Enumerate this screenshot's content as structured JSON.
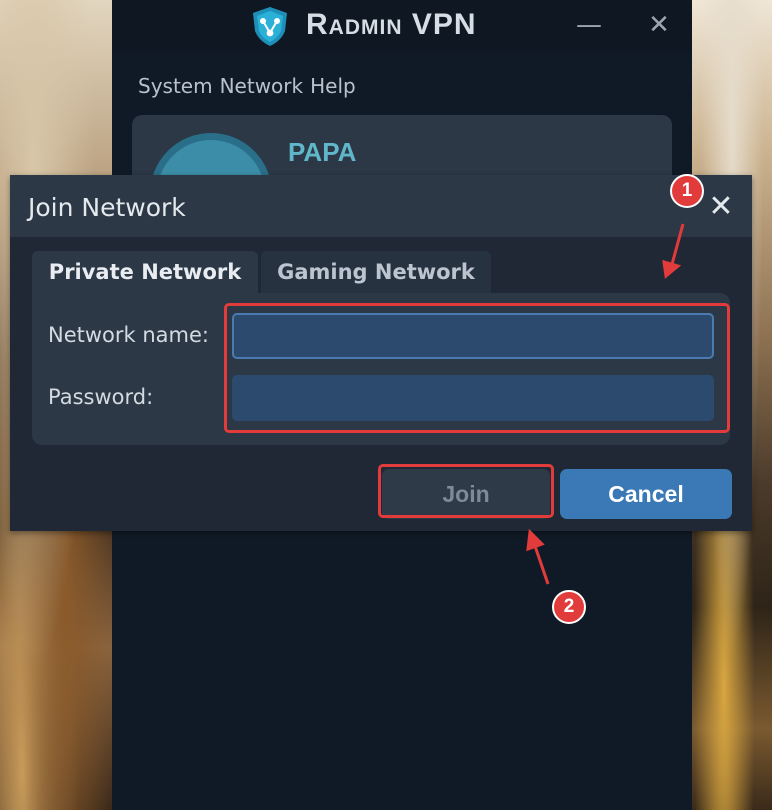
{
  "app": {
    "title": "Radmin VPN",
    "minimize_symbol": "—",
    "close_symbol": "✕"
  },
  "menu": {
    "items": [
      {
        "label": "System"
      },
      {
        "label": "Network"
      },
      {
        "label": "Help"
      }
    ]
  },
  "network_card": {
    "name": "PAPA"
  },
  "dialog": {
    "title": "Join Network",
    "close_symbol": "✕",
    "tabs": [
      {
        "label": "Private Network",
        "selected": true
      },
      {
        "label": "Gaming Network",
        "selected": false
      }
    ],
    "fields": {
      "network_name_label": "Network name:",
      "network_name_value": "",
      "password_label": "Password:",
      "password_value": ""
    },
    "buttons": {
      "join_label": "Join",
      "cancel_label": "Cancel"
    }
  },
  "annotations": {
    "marker_1": "1",
    "marker_2": "2",
    "highlight_color": "#e23b3b"
  },
  "colors": {
    "window_bg": "#101a26",
    "panel_bg": "#2c3846",
    "accent_blue": "#3a79b5",
    "network_name_color": "#5fb7c9"
  },
  "icons": {
    "logo": "radmin-shield-logo-icon",
    "avatar": "network-avatar-icon"
  }
}
